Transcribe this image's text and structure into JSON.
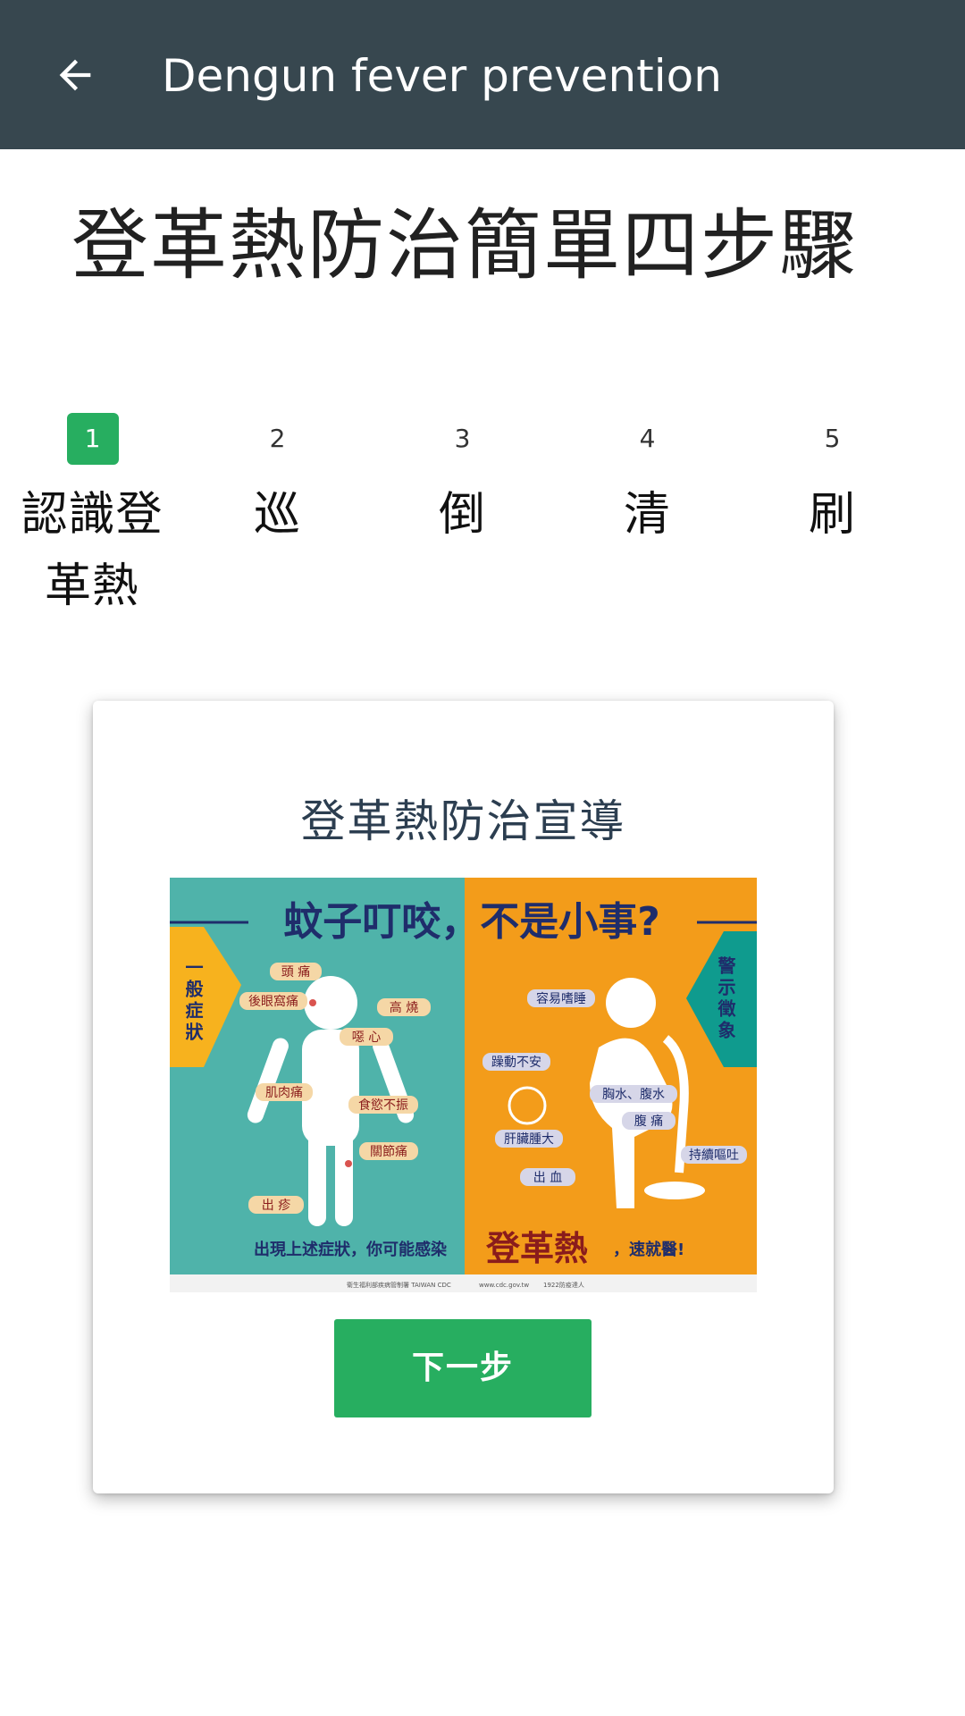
{
  "appbar": {
    "title": "Dengun fever prevention",
    "back_icon": "arrow-left-icon",
    "background": "#37474f"
  },
  "page": {
    "title": "登革熱防治簡單四步驟"
  },
  "stepper": {
    "active_index": 0,
    "active_color": "#27ae60",
    "steps": [
      {
        "number": "1",
        "label": "認識登革熱"
      },
      {
        "number": "2",
        "label": "巡"
      },
      {
        "number": "3",
        "label": "倒"
      },
      {
        "number": "4",
        "label": "清"
      },
      {
        "number": "5",
        "label": "刷"
      }
    ]
  },
  "card": {
    "title": "登革熱防治宣導",
    "next_label": "下一步",
    "poster": {
      "headline": "蚊子叮咬，不是小事?",
      "left_tag": "一般症狀",
      "right_tag": "警示徵象",
      "left_symptoms": [
        "頭 痛",
        "後眼窩痛",
        "高 燒",
        "噁 心",
        "肌肉痛",
        "食慾不振",
        "關節痛",
        "出 疹"
      ],
      "right_symptoms": [
        "容易嗜睡",
        "躁動不安",
        "胸水、腹水",
        "腹 痛",
        "肝臟腫大",
        "出 血",
        "持續嘔吐"
      ],
      "footer_pre": "出現上述症狀，你可能感染",
      "footer_big": "登革熱",
      "footer_post": "，速就醫!",
      "credits": [
        "衛生福利部疾病管制署 TAIWAN CDC",
        "www.cdc.gov.tw",
        "1922防疫達人"
      ],
      "colors": {
        "teal": "#4fb3aa",
        "orange": "#f39c1a",
        "navy": "#1f2d6b",
        "yellow": "#f7b21e",
        "dark_teal": "#0f9b8e"
      }
    }
  }
}
